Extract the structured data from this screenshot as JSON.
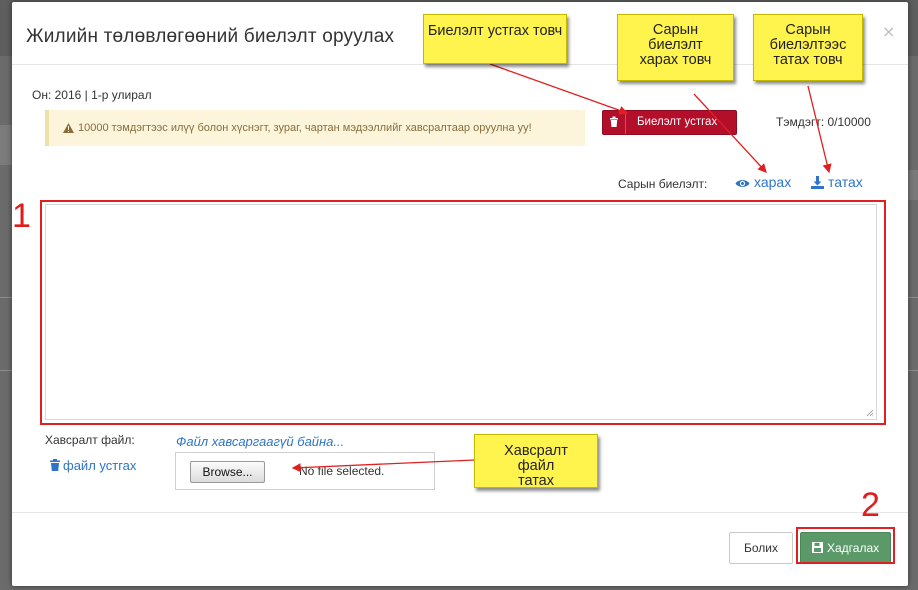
{
  "modal": {
    "title": "Жилийн төлөвлөгөөний биелэлт оруулах",
    "close_symbol": "×",
    "period": "Он: 2016 | 1-р улирал",
    "alert_text": "10000 тэмдэгтээс илүү болон хүснэгт, зураг, чартан мэдээллийг хавсралтаар оруулна уу!",
    "delete_report_label": "Биелэлт устгах",
    "char_count": "Тэмдэгт: 0/10000",
    "monthly_report_label": "Сарын биелэлт:",
    "view_label": "харах",
    "download_label": "татах",
    "attachment_label": "Хавсралт файл:",
    "no_file_text": "Файл хавсаргаагүй байна...",
    "delete_file_label": "файл устгах",
    "browse_label": "Browse...",
    "file_status": "No file selected.",
    "cancel_label": "Болих",
    "save_label": "Хадгалах"
  },
  "annotations": {
    "note_delete": "Биелэлт устгах товч",
    "note_view": "Сарын биелэлт харах товч",
    "note_download": "Сарын биелэлтээс татах товч",
    "note_attach": "Хавсралт файл татах",
    "step1": "1",
    "step2": "2"
  },
  "colors": {
    "delete_button": "#b30f2b",
    "save_button": "#5b9a68",
    "link": "#2e74c8",
    "note_bg": "#fff34d",
    "annotation_red": "#e02020"
  }
}
